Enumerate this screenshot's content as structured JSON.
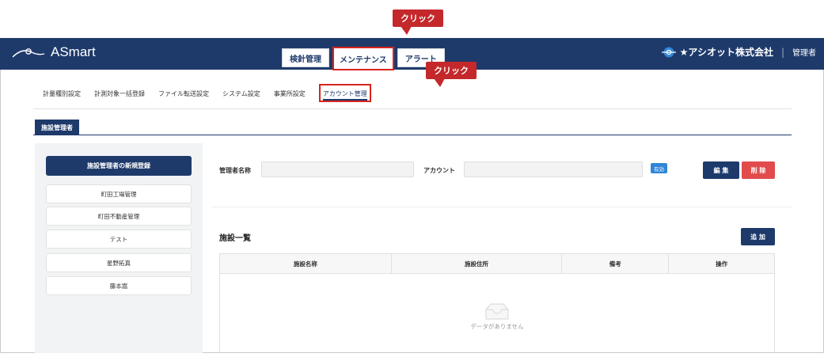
{
  "app": {
    "name": "ASmart"
  },
  "main_tabs": [
    {
      "label": "検針管理"
    },
    {
      "label": "メンテナンス"
    },
    {
      "label": "アラート"
    }
  ],
  "header": {
    "company": "★アシオット株式会社",
    "role": "管理者"
  },
  "callouts": [
    {
      "text": "クリック"
    },
    {
      "text": "クリック"
    }
  ],
  "subnav": [
    {
      "label": "計量種別設定"
    },
    {
      "label": "計測対象一括登録"
    },
    {
      "label": "ファイル転送設定"
    },
    {
      "label": "システム設定"
    },
    {
      "label": "事業所設定"
    },
    {
      "label": "アカウント管理"
    }
  ],
  "tab": {
    "label": "施設管理者"
  },
  "sidebar": {
    "primary": "施設管理者の新規登録",
    "items": [
      {
        "label": "町田工場管理"
      },
      {
        "label": "町田不動産管理"
      },
      {
        "label": "テスト"
      },
      {
        "label": "星野拓真"
      },
      {
        "label": "藤本嵩"
      }
    ]
  },
  "form": {
    "name_label": "管理者名称",
    "name_value": "",
    "account_label": "アカウント",
    "account_value": "",
    "status_badge": "有効",
    "edit_button": "編 集",
    "delete_button": "削 除"
  },
  "facilities": {
    "title": "施設一覧",
    "add_button": "追 加",
    "columns": [
      "施設名称",
      "施設住所",
      "備考",
      "操作"
    ],
    "empty_text": "データがありません"
  },
  "colors": {
    "navy": "#1e3a6b",
    "red": "#d9241b",
    "delete": "#e24b4b",
    "badge": "#2f86d6"
  }
}
